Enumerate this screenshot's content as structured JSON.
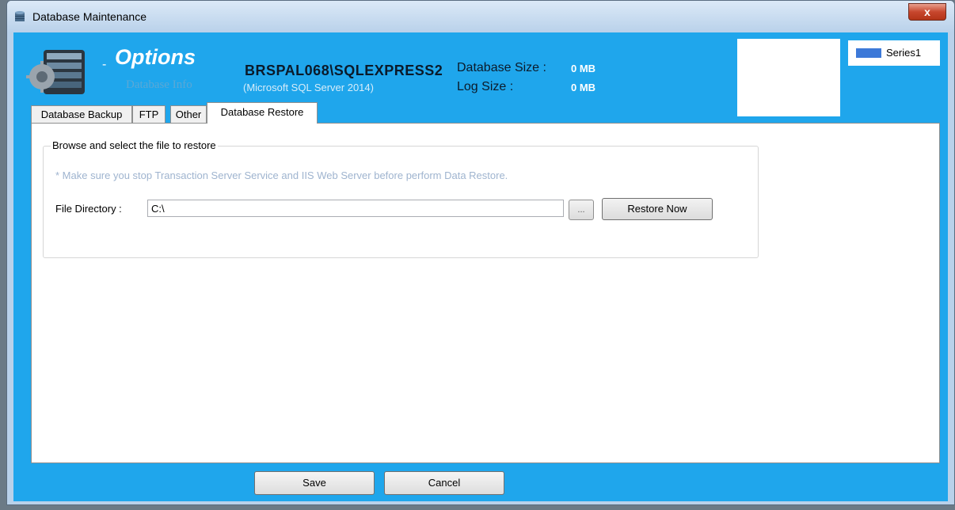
{
  "window": {
    "title": "Database Maintenance",
    "close_glyph": "x"
  },
  "header": {
    "title": "Options",
    "dash": "-",
    "subtitle": "Database Info",
    "server_name": "BRSPAL068\\SQLEXPRESS2",
    "server_version": "(Microsoft SQL Server 2014)",
    "db_size_label": "Database Size :",
    "db_size_value": "0 MB",
    "log_size_label": "Log Size    :",
    "log_size_value": "0 MB",
    "legend_series": "Series1",
    "legend_color": "#3d79d8"
  },
  "tabs": [
    {
      "label": "Database Backup"
    },
    {
      "label": "FTP"
    },
    {
      "label": "Other"
    },
    {
      "label": "Database Restore",
      "active": true
    }
  ],
  "restore": {
    "group_title": "Browse and select the file to restore",
    "warning": "* Make sure you stop Transaction Server Service and IIS Web Server before perform Data Restore.",
    "file_dir_label": "File Directory :",
    "file_dir_value": "C:\\",
    "browse_label": "...",
    "restore_label": "Restore Now"
  },
  "footer": {
    "save_label": "Save",
    "cancel_label": "Cancel"
  },
  "colors": {
    "header_bg": "#1fa6ec",
    "warning_text": "#9fb4cf"
  }
}
